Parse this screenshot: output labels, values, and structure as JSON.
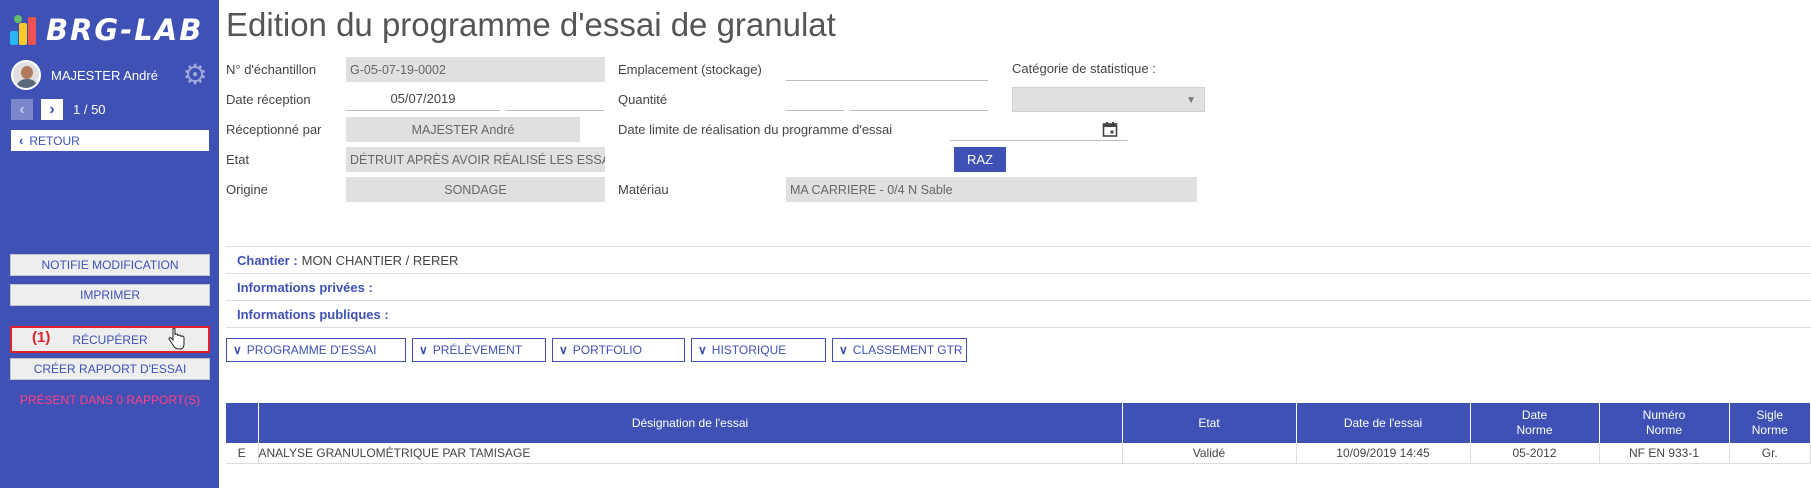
{
  "sidebar": {
    "logo_text": "BRG-LAB",
    "user_name": "MAJESTER André",
    "pager": "1 / 50",
    "retour_label": "RETOUR",
    "buttons": {
      "notifie": "NOTIFIE MODIFICATION",
      "imprimer": "IMPRIMER",
      "recuperer": "RÉCUPÉRER",
      "creer": "CRÉER RAPPORT D'ESSAI"
    },
    "annotation": "(1)",
    "present": "PRÉSENT DANS 0 RAPPORT(S)"
  },
  "header": {
    "title": "Edition du programme d'essai de granulat"
  },
  "form": {
    "echantillon_label": "N° d'échantillon",
    "echantillon_value": "G-05-07-19-0002",
    "date_reception_label": "Date réception",
    "date_reception_value": "05/07/2019",
    "receptionne_label": "Réceptionné par",
    "receptionne_value": "MAJESTER André",
    "etat_label": "Etat",
    "etat_value": "DÉTRUIT APRÈS AVOIR RÉALISÉ LES ESSAIS",
    "origine_label": "Origine",
    "origine_value": "SONDAGE",
    "emplacement_label": "Emplacement (stockage)",
    "quantite_label": "Quantité",
    "date_limite_label": "Date limite de réalisation  du programme d'essai",
    "materiau_label": "Matériau",
    "materiau_value": "MA CARRIERE - 0/4 N Sable",
    "categorie_label": "Catégorie de statistique :",
    "raz_label": "RAZ"
  },
  "info": {
    "chantier_label": "Chantier :",
    "chantier_value": "MON CHANTIER / RERER",
    "privees_label": "Informations privées :",
    "publiques_label": "Informations publiques :"
  },
  "tabs": [
    "PROGRAMME D'ESSAI",
    "PRÉLÈVEMENT",
    "PORTFOLIO",
    "HISTORIQUE",
    "CLASSEMENT GTR"
  ],
  "table": {
    "headers": {
      "designation": "Désignation de l'essai",
      "etat": "Etat",
      "date_essai": "Date de l'essai",
      "date_norme_1": "Date",
      "date_norme_2": "Norme",
      "numero_norme_1": "Numéro",
      "numero_norme_2": "Norme",
      "sigle_norme_1": "Sigle",
      "sigle_norme_2": "Norme"
    },
    "rows": [
      {
        "marker": "E",
        "designation": "ANALYSE GRANULOMÉTRIQUE PAR TAMISAGE",
        "etat": "Validé",
        "date_essai": "10/09/2019 14:45",
        "date_norme": "05-2012",
        "numero_norme": "NF EN 933-1",
        "sigle_norme": "Gr."
      }
    ]
  },
  "colors": {
    "brand": "#3f51b5",
    "accent_pink": "#e91e63",
    "status_ok": "#2e7d32",
    "annotation_red": "#e0202a"
  }
}
